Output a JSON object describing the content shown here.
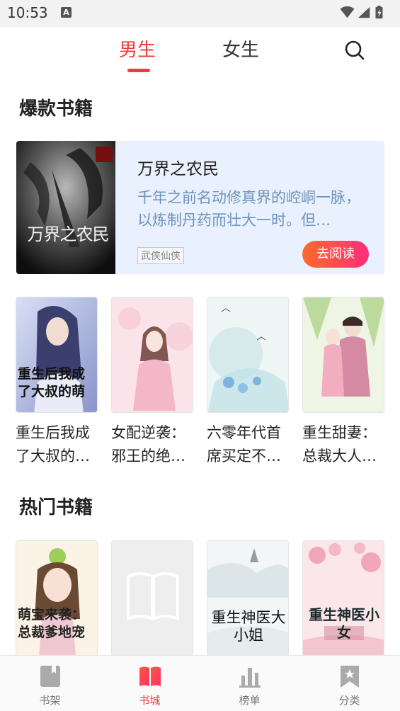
{
  "status_bar": {
    "time": "10:53",
    "notification_badge": "A"
  },
  "top_tabs": [
    {
      "label": "男生",
      "active": true
    },
    {
      "label": "女生",
      "active": false
    }
  ],
  "sections": {
    "hot_sale": "爆款书籍",
    "popular": "热门书籍"
  },
  "featured": {
    "title": "万界之农民",
    "description": "千年之前名动修真界的崆峒一脉，以炼制丹药而壮大一时。但…",
    "tag": "武侠仙侠",
    "read_button": "去阅读",
    "cover_text": "万界之农民"
  },
  "hot_books": [
    {
      "title": "重生后我成了大叔的…",
      "cover_text": "重生后我成了大叔的萌"
    },
    {
      "title": "女配逆袭：邪王的绝…"
    },
    {
      "title": "六零年代首席买定不…"
    },
    {
      "title": "重生甜妻：总裁大人…"
    }
  ],
  "popular_books": [
    {
      "cover_text": "萌宝来袭：总裁爹地宠"
    },
    {
      "cover_text": ""
    },
    {
      "cover_text": "重生神医大小姐"
    },
    {
      "cover_text": "重生神医小女"
    }
  ],
  "bottom_nav": [
    {
      "label": "书架",
      "icon": "book-icon",
      "active": false
    },
    {
      "label": "书城",
      "icon": "open-book-icon",
      "active": true
    },
    {
      "label": "榜单",
      "icon": "bar-chart-icon",
      "active": false
    },
    {
      "label": "分类",
      "icon": "bookmark-star-icon",
      "active": false
    }
  ],
  "colors": {
    "accent": "#ee3b3b",
    "featured_bg": "#e8f1fd",
    "desc_text": "#6f93bf"
  }
}
